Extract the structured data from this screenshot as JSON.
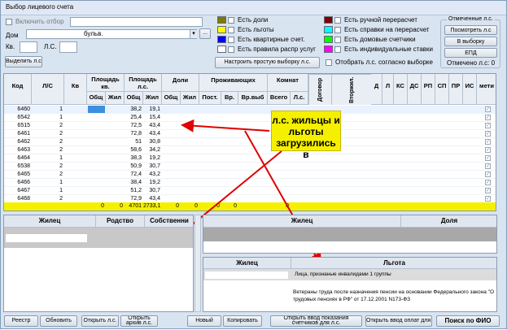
{
  "window": {
    "title": "Выбор лицевого счета"
  },
  "filter": {
    "enable_label": "Включить отбор",
    "house_label": "Дом",
    "house_value": "бульв.",
    "kv_label": "Кв.",
    "ls_label": "Л.С.",
    "select_ls_button": "Выделить л.с."
  },
  "checks_mid": [
    "Есть доли",
    "Есть льготы",
    "Есть квартирные счет.",
    "Есть правила распр услуг"
  ],
  "colors_mid": [
    "#7b7b00",
    "#ffff00",
    "#0000ff",
    "#ffffff"
  ],
  "checks_right": [
    "Есть ручной перерасчет",
    "Есть справки на перерасчет",
    "Есть домовые счетчики",
    "Есть индивидуальные ставки"
  ],
  "colors_right": [
    "#7b0000",
    "#00ffff",
    "#00ff00",
    "#ff00ff"
  ],
  "configure_button": "Настроить простую выборку л.с.",
  "select_agree_label": "Отобрать л.с. согласно выборке",
  "marked": {
    "title": "Отмеченные л.с.",
    "view_button": "Посмотреть л.с",
    "to_select_button": "В выборку",
    "epd_button": "ЕПД",
    "count_label": "Отмечено л.с: 0"
  },
  "grid": {
    "headers": {
      "kod": "Код",
      "ls": "Л/С",
      "kv": "Кв",
      "area_kv": "Площадь кв.",
      "area_ls": "Площадь л.с.",
      "doli": "Доли",
      "prozh": "Проживающих",
      "komnat": "Комнат",
      "dogovor": "Договор",
      "vtorzh": "Вторжил.",
      "d": "Д",
      "l": "Л",
      "ks": "КС",
      "ds": "ДС",
      "rp": "РП",
      "sp": "СП",
      "pr": "ПР",
      "is": "ИС",
      "meti": "мети"
    },
    "subheaders": {
      "obsh1": "Общ",
      "zhil1": "Жил",
      "obsh2": "Общ",
      "zhil2": "Жил",
      "obsh3": "Общ",
      "zhil3": "Жил",
      "post": "Пост.",
      "vr": "Вр.",
      "vrvyb": "Вр.выб",
      "vsego": "Всего",
      "ls2": "Л.с."
    },
    "rows": [
      {
        "kod": "6460",
        "kv": "1",
        "obsh": "38,2",
        "zhil": "19,1"
      },
      {
        "kod": "6542",
        "kv": "1",
        "obsh": "25,4",
        "zhil": "15,4"
      },
      {
        "kod": "6515",
        "kv": "2",
        "obsh": "72,5",
        "zhil": "43,4"
      },
      {
        "kod": "6461",
        "kv": "2",
        "obsh": "72,8",
        "zhil": "43,4"
      },
      {
        "kod": "6462",
        "kv": "2",
        "obsh": "51",
        "zhil": "30,8"
      },
      {
        "kod": "6463",
        "kv": "2",
        "obsh": "58,6",
        "zhil": "34,2"
      },
      {
        "kod": "6464",
        "kv": "1",
        "obsh": "38,3",
        "zhil": "19,2"
      },
      {
        "kod": "6538",
        "kv": "2",
        "obsh": "50,9",
        "zhil": "30,7"
      },
      {
        "kod": "6465",
        "kv": "2",
        "obsh": "72,4",
        "zhil": "43,2"
      },
      {
        "kod": "6466",
        "kv": "1",
        "obsh": "38,4",
        "zhil": "19,2"
      },
      {
        "kod": "6467",
        "kv": "1",
        "obsh": "51,2",
        "zhil": "30,7"
      },
      {
        "kod": "6468",
        "kv": "2",
        "obsh": "72,9",
        "zhil": "43,4"
      }
    ],
    "totals": {
      "a": "0",
      "b": "0",
      "obsh": "4701",
      "zhil": "2733,1",
      "c": "0",
      "d": "0",
      "e": "0",
      "f": "0",
      "g": "0"
    }
  },
  "note": "л.с. жильцы и льготы загрузились в",
  "residents": {
    "h_zhilec": "Жилец",
    "h_rodstvo": "Родство",
    "h_sobstv": "Собственни"
  },
  "shares": {
    "h_zhilec": "Жилец",
    "h_dolya": "Доля"
  },
  "benefits": {
    "h_zhilec": "Жилец",
    "h_lgota": "Льгота",
    "item1": "Лица, признаные инвалидами 1 группы",
    "item2": "Ветераны труда после назначения пенсии на основании Федерального закона \"О трудовых пенсиях в РФ\" от 17.12.2001 N173-ФЗ"
  },
  "bottom": {
    "reestr": "Реестр",
    "obnovit": "Обновить",
    "open_ls": "Открыть л.с.",
    "open_arch": "Открыть архив л.с.",
    "novyi": "Новый",
    "copy": "Копировать",
    "input_counters": "Открыть ввод показания счетчиков для л.с.",
    "input_payments": "Открыть ввод оплат для л.с.",
    "search_fio": "Поиск по ФИО"
  }
}
